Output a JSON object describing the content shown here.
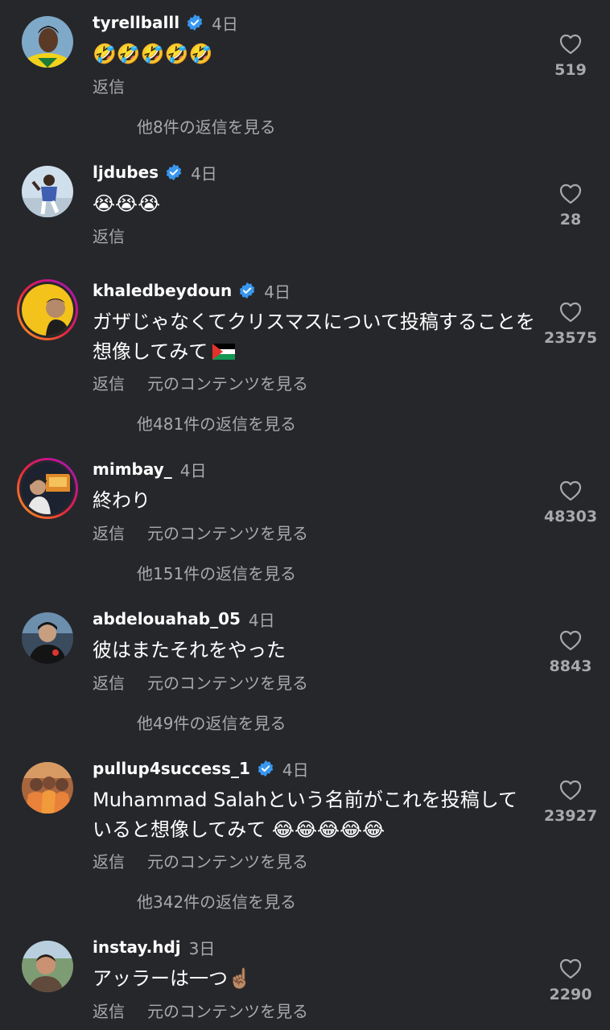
{
  "comments": [
    {
      "username": "tyrellballl",
      "verified": true,
      "time": "4日",
      "text": "🤣🤣🤣🤣🤣",
      "reply_label": "返信",
      "view_original_label": "",
      "view_replies": "他8件の返信を見る",
      "likes": "519"
    },
    {
      "username": "ljdubes",
      "verified": true,
      "time": "4日",
      "text": "😭😭😭",
      "reply_label": "返信",
      "view_original_label": "",
      "view_replies": "",
      "likes": "28"
    },
    {
      "username": "khaledbeydoun",
      "verified": true,
      "time": "4日",
      "text": "ガザじゃなくてクリスマスについて投稿することを想像してみて",
      "reply_label": "返信",
      "view_original_label": "元のコンテンツを見る",
      "view_replies": "他481件の返信を見る",
      "likes": "23575"
    },
    {
      "username": "mimbay_",
      "verified": false,
      "time": "4日",
      "text": "終わり",
      "reply_label": "返信",
      "view_original_label": "元のコンテンツを見る",
      "view_replies": "他151件の返信を見る",
      "likes": "48303"
    },
    {
      "username": "abdelouahab_05",
      "verified": false,
      "time": "4日",
      "text": "彼はまたそれをやった",
      "reply_label": "返信",
      "view_original_label": "元のコンテンツを見る",
      "view_replies": "他49件の返信を見る",
      "likes": "8843"
    },
    {
      "username": "pullup4success_1",
      "verified": true,
      "time": "4日",
      "text": "Muhammad Salahという名前がこれを投稿していると想像してみて 😂😂😂😂😂",
      "reply_label": "返信",
      "view_original_label": "元のコンテンツを見る",
      "view_replies": "他342件の返信を見る",
      "likes": "23927"
    },
    {
      "username": "instay.hdj",
      "verified": false,
      "time": "3日",
      "text": "アッラーは一つ☝🏽",
      "reply_label": "返信",
      "view_original_label": "元のコンテンツを見る",
      "view_replies": "",
      "likes": "2290"
    }
  ],
  "icons": {
    "like": "heart-outline-icon",
    "verified": "verified-badge-icon",
    "flag": "palestine-flag-icon"
  },
  "colors": {
    "background": "#26272b",
    "secondary_text": "#a8a9ad",
    "verified": "#3897f0"
  }
}
